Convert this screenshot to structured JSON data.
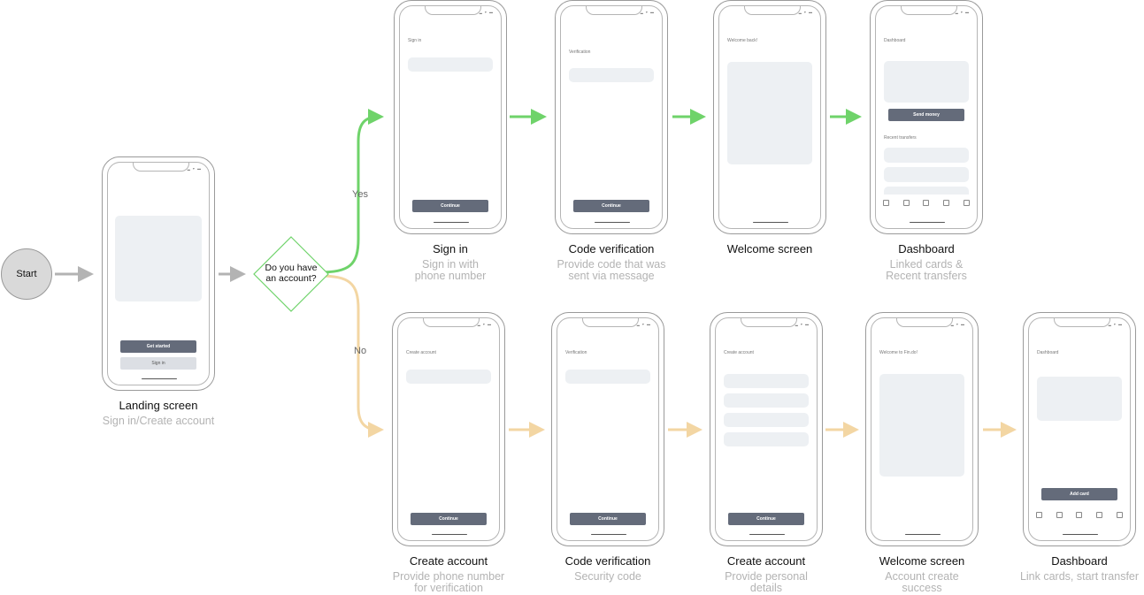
{
  "start": {
    "label": "Start"
  },
  "decision": {
    "question_line1": "Do you have",
    "question_line2": "an account?",
    "yes_label": "Yes",
    "no_label": "No"
  },
  "colors": {
    "yes": "#6fd36a",
    "no": "#f3d6a3",
    "neutral": "#b3b3b3"
  },
  "status_icons": "▂ ▾ ▬",
  "phones": [
    {
      "id": "landing",
      "title": "",
      "buttons": [
        "Get started",
        "Sign in"
      ],
      "caption": "Landing screen",
      "sub": [
        "Sign in/Create account"
      ]
    },
    {
      "id": "signin",
      "title": "Sign in",
      "buttons": [
        "Continue"
      ],
      "caption": "Sign in",
      "sub": [
        "Sign in with",
        "phone number"
      ]
    },
    {
      "id": "verify1",
      "title": "Verification",
      "buttons": [
        "Continue"
      ],
      "caption": "Code verification",
      "sub": [
        "Provide code that was",
        "sent via message"
      ]
    },
    {
      "id": "welcome1",
      "title": "Welcome back!",
      "buttons": [],
      "caption": "Welcome screen",
      "sub": []
    },
    {
      "id": "dash1",
      "title": "Dashboard",
      "section": "Recent transfers",
      "buttons": [
        "Send money"
      ],
      "caption": "Dashboard",
      "sub": [
        "Linked cards &",
        "Recent transfers"
      ]
    },
    {
      "id": "create1",
      "title": "Create account",
      "buttons": [
        "Continue"
      ],
      "caption": "Create account",
      "sub": [
        "Provide phone number",
        "for verification"
      ]
    },
    {
      "id": "verify2",
      "title": "Verification",
      "buttons": [
        "Continue"
      ],
      "caption": "Code verification",
      "sub": [
        "Security code"
      ]
    },
    {
      "id": "create2",
      "title": "Create account",
      "buttons": [
        "Continue"
      ],
      "caption": "Create account",
      "sub": [
        "Provide personal",
        "details"
      ]
    },
    {
      "id": "welcome2",
      "title": "Welcome to Fin.do!",
      "buttons": [],
      "caption": "Welcome screen",
      "sub": [
        "Account create",
        "success"
      ]
    },
    {
      "id": "dash2",
      "title": "Dashboard",
      "buttons": [
        "Add card"
      ],
      "caption": "Dashboard",
      "sub": [
        "Link cards, start transfer"
      ]
    }
  ]
}
